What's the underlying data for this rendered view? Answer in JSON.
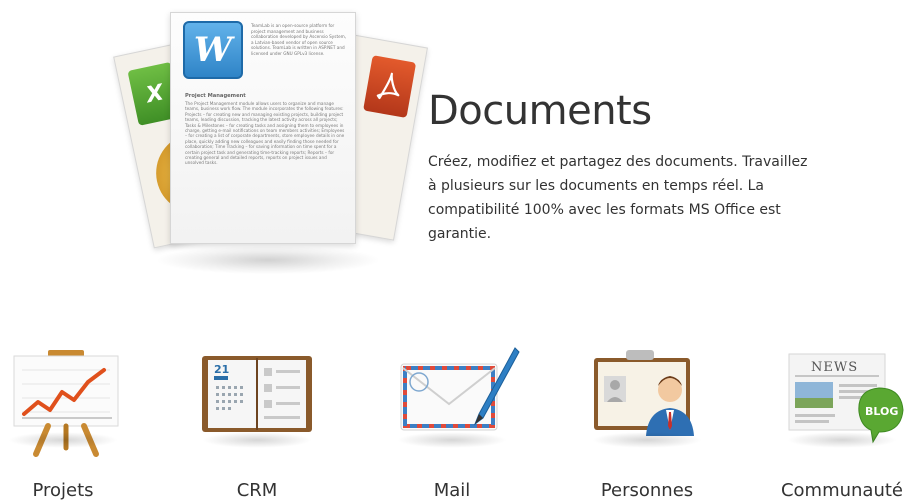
{
  "hero": {
    "title": "Documents",
    "description": "Créez, modifiez et partagez des documents. Travaillez à plusieurs sur les documents en temps réel. La compatibilité 100% avec les formats MS Office est garantie.",
    "document_preview": {
      "word_badge_letter": "W",
      "excel_badge_letter": "X",
      "intro_text": "TeamLab is an open-source platform for project management and business collaboration developed by Ascensio System, a Latvian-based vendor of open source solutions. TeamLab is written in ASP.NET and licensed under GNU GPLv3 license.",
      "section_heading": "Project Management",
      "section_body": "The Project Management module allows users to organize and manage teams, business work flow. The module incorporates the following features: Projects – for creating new and managing existing projects, building project teams, leading discussion, tracking the latest activity across all projects; Tasks & Milestones – for creating tasks and assigning them to employees in charge, getting e-mail notifications on team members activities; Employees – for creating a list of corporate departments, store employee details in one place, quickly adding new colleagues and easily finding those needed for collaboration; Time Tracking – for saving information on time spent for a certain project task and generating time-tracking reports; Reports – for creating general and detailed reports, reports on project issues and unsolved tasks."
    }
  },
  "features": [
    {
      "label": "Projets",
      "icon": "presentation-chart-icon"
    },
    {
      "label": "CRM",
      "icon": "calendar-book-icon"
    },
    {
      "label": "Mail",
      "icon": "envelope-pen-icon"
    },
    {
      "label": "Personnes",
      "icon": "person-card-icon"
    },
    {
      "label": "Communauté",
      "icon": "news-blog-icon",
      "badge": "BLOG",
      "headline": "NEWS"
    }
  ],
  "crm_icon": {
    "day": "21"
  },
  "colors": {
    "text": "#333333",
    "excel": "#4f9f2f",
    "word": "#2f84c7",
    "pdf": "#c9441f",
    "chart_line": "#e0501c",
    "blog_bubble": "#5aa832"
  }
}
